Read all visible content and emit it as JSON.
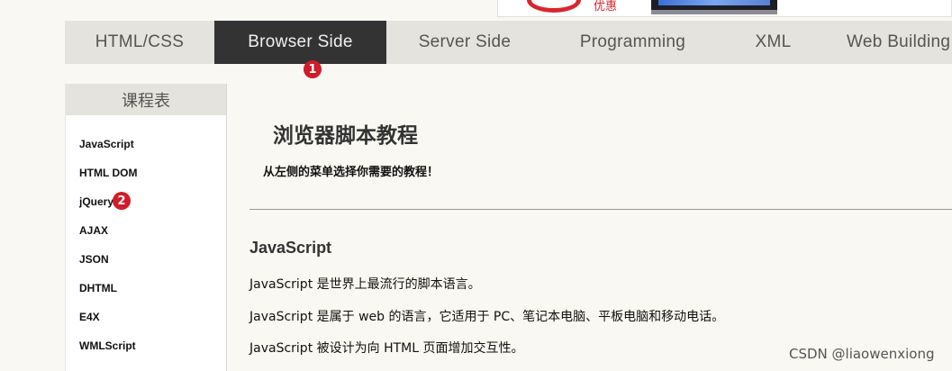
{
  "ad": {
    "text": "优惠"
  },
  "nav": {
    "tabs": [
      {
        "label": "HTML/CSS"
      },
      {
        "label": "Browser Side",
        "active": true
      },
      {
        "label": "Server Side"
      },
      {
        "label": "Programming"
      },
      {
        "label": "XML"
      },
      {
        "label": "Web Building"
      }
    ]
  },
  "markers": {
    "m1": "1",
    "m2": "2"
  },
  "sidebar": {
    "title": "课程表",
    "items": [
      {
        "label": "JavaScript"
      },
      {
        "label": "HTML DOM"
      },
      {
        "label": "jQuery"
      },
      {
        "label": "AJAX"
      },
      {
        "label": "JSON"
      },
      {
        "label": "DHTML"
      },
      {
        "label": "E4X"
      },
      {
        "label": "WMLScript"
      }
    ]
  },
  "main": {
    "title": "浏览器脚本教程",
    "subtitle": "从左侧的菜单选择你需要的教程！",
    "section": {
      "heading": "JavaScript",
      "paragraphs": [
        "JavaScript 是世界上最流行的脚本语言。",
        "JavaScript 是属于 web 的语言，它适用于 PC、笔记本电脑、平板电脑和移动电话。",
        "JavaScript 被设计为向 HTML 页面增加交互性。"
      ]
    }
  },
  "watermark": "CSDN @liaowenxiong",
  "colors": {
    "background": "#f9f8f2",
    "nav_bg": "#e4e3dd",
    "nav_active_bg": "#333333",
    "marker": "#d01c28"
  }
}
